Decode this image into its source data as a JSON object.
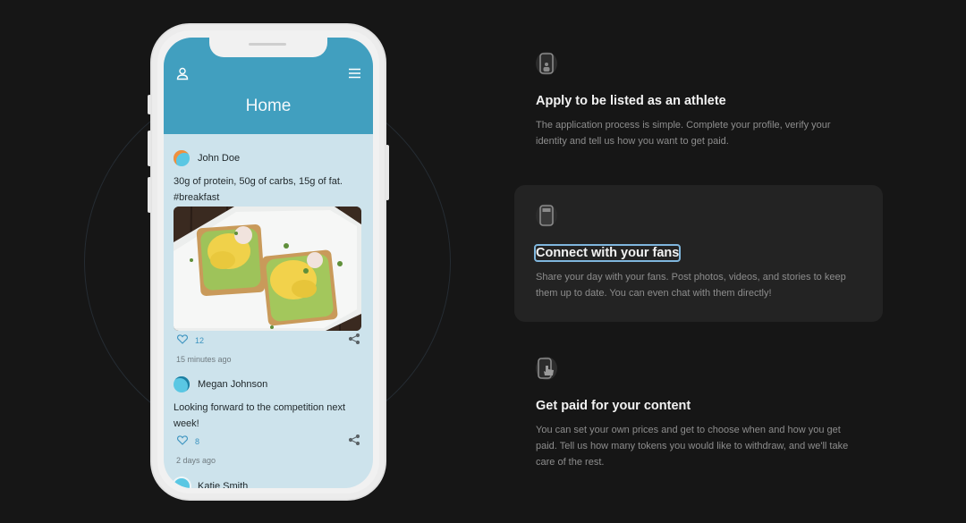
{
  "phone": {
    "app_title": "Home",
    "icons": {
      "left": "user-icon",
      "right": "menu-icon"
    },
    "posts": [
      {
        "author": "John Doe",
        "text": "30g of protein, 50g of carbs, 15g of fat. #breakfast",
        "image": "avocado-toast-with-scrambled-eggs",
        "likes": "12",
        "time": "15 minutes ago"
      },
      {
        "author": "Megan Johnson",
        "text": "Looking forward to the competition next week!",
        "likes": "8",
        "time": "2 days ago"
      },
      {
        "author": "Katie Smith"
      }
    ]
  },
  "features": [
    {
      "icon": "phone-person-icon",
      "title": "Apply to be listed as an athlete",
      "description": "The application process is simple. Complete your profile, verify your identity and tell us how you want to get paid."
    },
    {
      "icon": "phone-feed-icon",
      "title": "Connect with your fans",
      "description": "Share your day with your fans. Post photos, videos, and stories to keep them up to date. You can even chat with them directly!",
      "active": true
    },
    {
      "icon": "phone-tap-icon",
      "title": "Get paid for your content",
      "description": "You can set your own prices and get to choose when and how you get paid. Tell us how many tokens you would like to withdraw, and we'll take care of the rest."
    }
  ],
  "colors": {
    "background": "#161616",
    "app_header": "#419fbf",
    "feed_bg": "#cde3ec",
    "active_card": "#232323",
    "focus_outline": "#7fb6dd"
  }
}
